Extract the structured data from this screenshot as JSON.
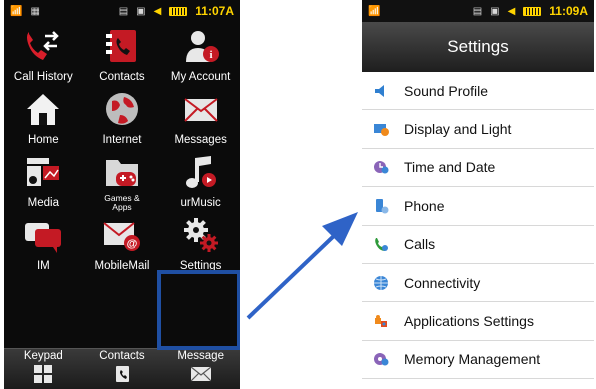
{
  "left_phone": {
    "status": {
      "time": "11:07A"
    },
    "apps": [
      {
        "label": "Call History",
        "icon": "call-history-icon"
      },
      {
        "label": "Contacts",
        "icon": "contacts-icon"
      },
      {
        "label": "My Account",
        "icon": "my-account-icon"
      },
      {
        "label": "Home",
        "icon": "home-icon"
      },
      {
        "label": "Internet",
        "icon": "globe-icon"
      },
      {
        "label": "Messages",
        "icon": "envelope-icon"
      },
      {
        "label": "Media",
        "icon": "media-icon"
      },
      {
        "label": "Games & Apps",
        "icon": "gamepad-icon"
      },
      {
        "label": "urMusic",
        "icon": "music-note-icon"
      },
      {
        "label": "IM",
        "icon": "chat-bubble-icon"
      },
      {
        "label": "MobileMail",
        "icon": "mobile-mail-icon"
      },
      {
        "label": "Settings",
        "icon": "gear-icon"
      }
    ],
    "dock": [
      {
        "label": "Keypad",
        "icon": "keypad-icon"
      },
      {
        "label": "Contacts",
        "icon": "contacts-icon"
      },
      {
        "label": "Message",
        "icon": "envelope-icon"
      }
    ]
  },
  "right_phone": {
    "status": {
      "time": "11:09A"
    },
    "title": "Settings",
    "menu": [
      {
        "label": "Sound Profile",
        "icon": "speaker-icon"
      },
      {
        "label": "Display and Light",
        "icon": "display-icon"
      },
      {
        "label": "Time and Date",
        "icon": "clock-icon"
      },
      {
        "label": "Phone",
        "icon": "phone-icon"
      },
      {
        "label": "Calls",
        "icon": "handset-icon"
      },
      {
        "label": "Connectivity",
        "icon": "globe-icon"
      },
      {
        "label": "Applications Settings",
        "icon": "puzzle-icon"
      },
      {
        "label": "Memory Management",
        "icon": "gear-globe-icon"
      }
    ]
  },
  "colors": {
    "highlight": "#1f4fa3",
    "arrow": "#2f63c7",
    "status_accent": "#ffd400",
    "icon_red": "#d81e2a"
  }
}
